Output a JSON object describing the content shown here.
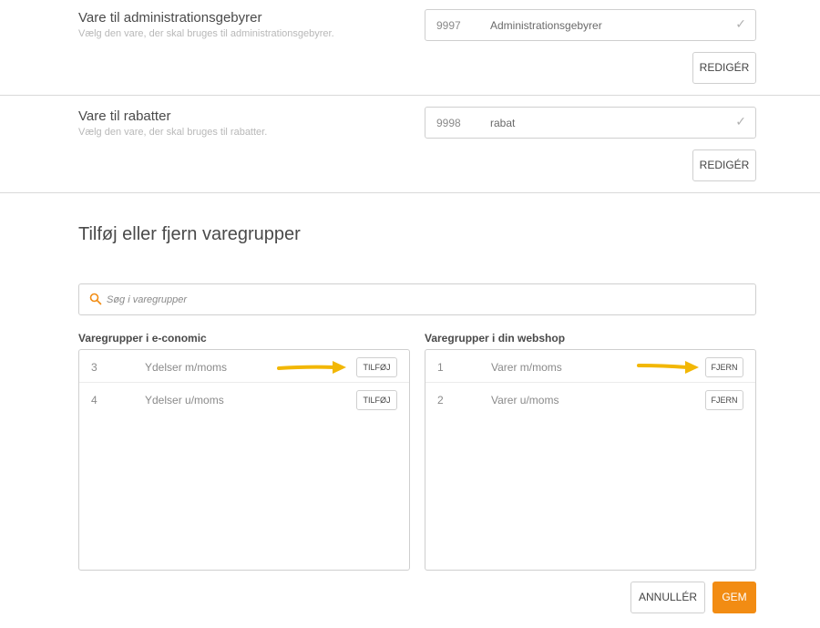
{
  "admin_fee": {
    "title": "Vare til administrationsgebyrer",
    "description": "Vælg den vare, der skal bruges til administrationsgebyrer.",
    "selected_number": "9997",
    "selected_name": "Administrationsgebyrer",
    "edit_label": "REDIGÉR"
  },
  "discount": {
    "title": "Vare til rabatter",
    "description": "Vælg den vare, der skal bruges til rabatter.",
    "selected_number": "9998",
    "selected_name": "rabat",
    "edit_label": "REDIGÉR"
  },
  "groups": {
    "heading": "Tilføj eller fjern varegrupper",
    "search_placeholder": "Søg i varegrupper",
    "economic_label": "Varegrupper i e-conomic",
    "webshop_label": "Varegrupper i din webshop",
    "economic_items": [
      {
        "number": "3",
        "name": "Ydelser m/moms",
        "action": "TILFØJ"
      },
      {
        "number": "4",
        "name": "Ydelser u/moms",
        "action": "TILFØJ"
      }
    ],
    "webshop_items": [
      {
        "number": "1",
        "name": "Varer m/moms",
        "action": "FJERN"
      },
      {
        "number": "2",
        "name": "Varer u/moms",
        "action": "FJERN"
      }
    ]
  },
  "footer": {
    "cancel_label": "ANNULLÉR",
    "save_label": "GEM"
  },
  "colors": {
    "accent": "#f28c13",
    "arrow": "#f2b705",
    "border": "#cfcfcf"
  },
  "icons": {
    "search": "search-icon",
    "check": "checkmark-icon",
    "arrow": "arrow-right-icon"
  }
}
